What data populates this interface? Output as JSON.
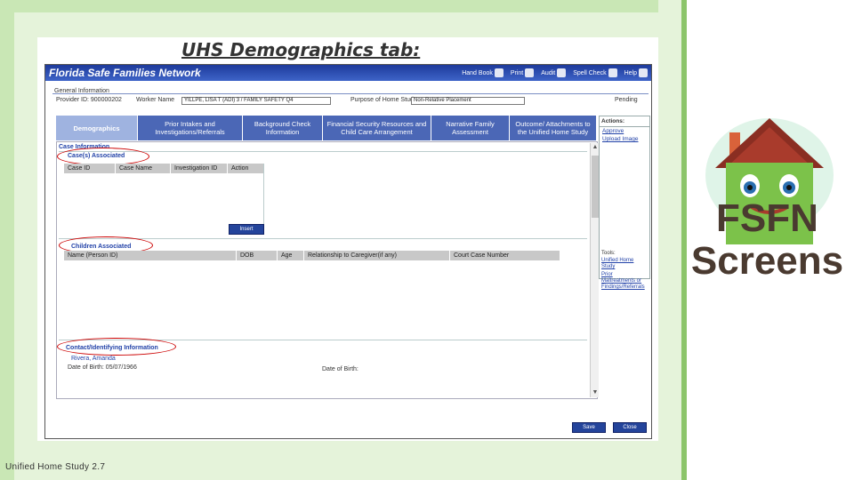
{
  "slide": {
    "title": "UHS Demographics tab:",
    "footer": "Unified Home Study 2.7",
    "side_label": "FSFN Screens"
  },
  "app": {
    "name": "Florida Safe Families Network",
    "toolbar": [
      "Hand Book",
      "Print",
      "Audit",
      "Spell Check",
      "Help"
    ],
    "section_general": "General Information",
    "provider_id": "Provider ID: 900000202",
    "worker_name_label": "Worker Name",
    "worker_name_value": "YILLPE, LISA T (ADI) 3 / FAMILY SAFETY Q4",
    "purpose_label": "Purpose of Home Study",
    "purpose_value": "Non-Relative Placement",
    "status": "Pending",
    "tabs": [
      "Demographics",
      "Prior Intakes and Investigations/Referrals",
      "Background Check Information",
      "Financial Security Resources and Child Care Arrangement",
      "Narrative Family Assessment",
      "Outcome/ Attachments to the Unified Home Study"
    ],
    "actions": {
      "header": "Actions:",
      "items": [
        "Approve",
        "Upload Image"
      ]
    },
    "tools": {
      "header": "Tools:",
      "items": [
        "Unified Home Study",
        "Prior Maltreatments or Findings/Referrals"
      ]
    },
    "case_info": "Case Information",
    "cases_associated": "Case(s) Associated",
    "cases_columns": [
      "Case ID",
      "Case Name",
      "Investigation ID",
      "Action"
    ],
    "insert_label": "Insert",
    "children_associated": "Children Associated",
    "children_columns": [
      "Name (Person ID)",
      "DOB",
      "Age",
      "Relationship to Caregiver(if any)",
      "Court Case Number"
    ],
    "contact_info": "Contact/Identifying Information",
    "contact_name": "Rivera, Amanda",
    "contact_dob": "Date of Birth: 05/07/1966",
    "date_of_birth": "Date of Birth:",
    "save_label": "Save",
    "close_label": "Close"
  }
}
